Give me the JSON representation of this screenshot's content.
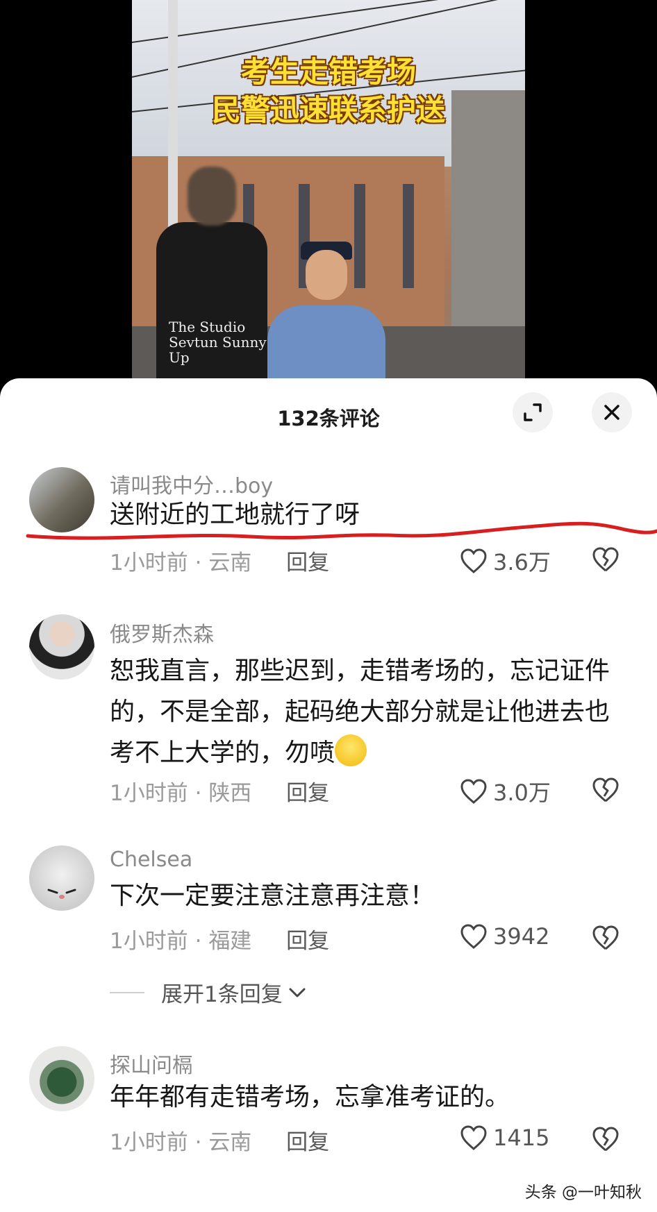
{
  "video": {
    "caption_line1": "考生走错考场",
    "caption_line2": "民警迅速联系护送",
    "shirt_text": "The Studio Sevtun Sunny Up"
  },
  "panel": {
    "title": "132条评论"
  },
  "comments": [
    {
      "username": "请叫我中分…boy",
      "text": "送附近的工地就行了呀",
      "time": "1小时前",
      "location": "云南",
      "reply_label": "回复",
      "likes": "3.6万"
    },
    {
      "username": "俄罗斯杰森",
      "text": "恕我直言，那些迟到，走错考场的，忘记证件的，不是全部，起码绝大部分就是让他进去也考不上大学的，勿喷",
      "time": "1小时前",
      "location": "陕西",
      "reply_label": "回复",
      "likes": "3.0万"
    },
    {
      "username": "Chelsea",
      "text": "下次一定要注意注意再注意！",
      "time": "1小时前",
      "location": "福建",
      "reply_label": "回复",
      "likes": "3942",
      "expand_replies": "展开1条回复"
    },
    {
      "username": "探山问槅",
      "text": "年年都有走错考场，忘拿准考证的。",
      "time": "1小时前",
      "location": "云南",
      "reply_label": "回复",
      "likes": "1415"
    }
  ],
  "watermark": "头条 @一叶知秋",
  "colors": {
    "caption": "#ffe135",
    "highlight_underline": "#d81e1e",
    "panel_bg": "#ffffff"
  },
  "icons": [
    "expand-icon",
    "close-icon",
    "heart-icon",
    "broken-heart-icon",
    "chevron-down-icon",
    "smile-emoji"
  ]
}
